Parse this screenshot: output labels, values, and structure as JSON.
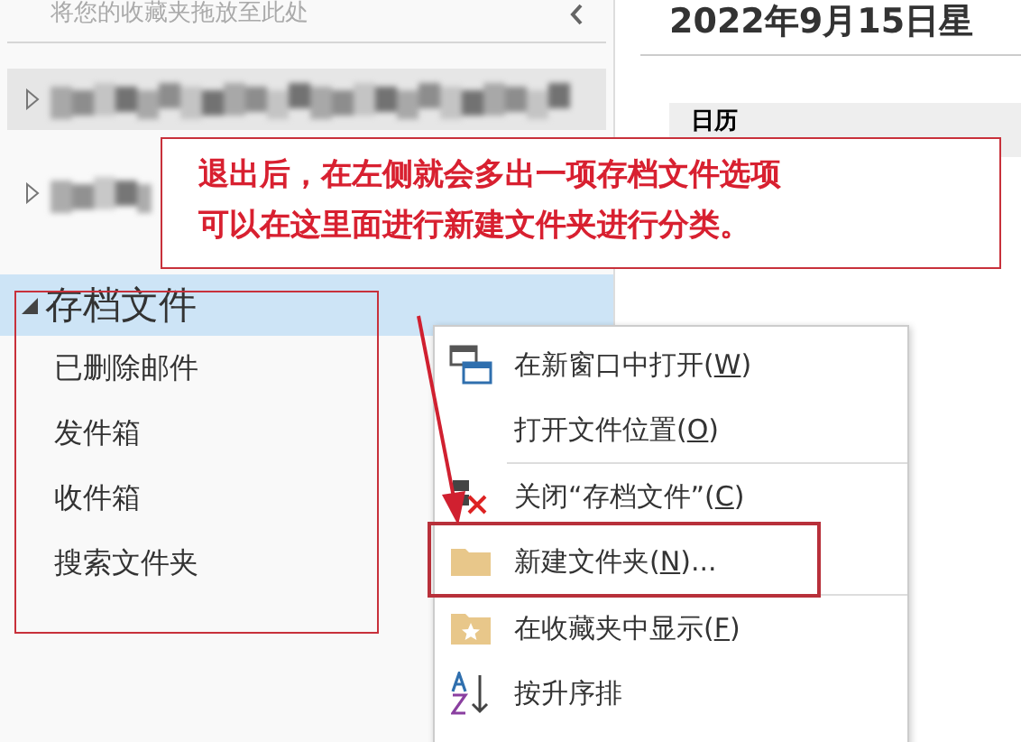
{
  "favorites_hint": "将您的收藏夹拖放至此处",
  "accounts": [
    {
      "selected": true
    },
    {
      "selected": false
    }
  ],
  "archive": {
    "title": "存档文件",
    "expanded": true,
    "selected": true,
    "folders": [
      "已删除邮件",
      "发件箱",
      "收件箱",
      "搜索文件夹"
    ]
  },
  "date_title": "2022年9月15日星",
  "calendar_label": "日历",
  "annotation": [
    "退出后，在左侧就会多出一项存档文件选项",
    "可以在这里面进行新建文件夹进行分类。"
  ],
  "context_menu": [
    {
      "kind": "window",
      "before": "在新窗口中打开(",
      "key": "W",
      "after": ")"
    },
    {
      "kind": "none",
      "before": "打开文件位置(",
      "key": "O",
      "after": ")"
    },
    {
      "kind": "close",
      "before": "关闭“存档文件”(",
      "key": "C",
      "after": ")"
    },
    {
      "kind": "folder",
      "before": "新建文件夹(",
      "key": "N",
      "after": ")..."
    },
    {
      "kind": "star-folder",
      "before": "在收藏夹中显示(",
      "key": "F",
      "after": ")"
    },
    {
      "kind": "sort",
      "before": "按升序排"
    }
  ]
}
